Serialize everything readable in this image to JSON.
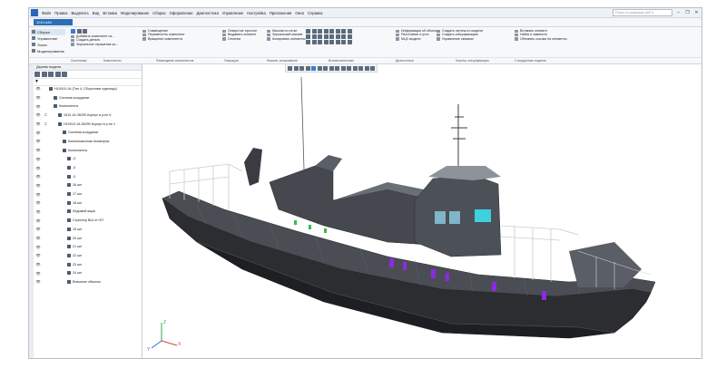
{
  "menu": [
    "Файл",
    "Правка",
    "Выделить",
    "Вид",
    "Вставка",
    "Моделирование",
    "Сборка",
    "Оформление",
    "Диагностика",
    "Управление",
    "Настройка",
    "Приложения",
    "Окно",
    "Справка"
  ],
  "search": {
    "placeholder": "Поиск по командам (Alt+/)"
  },
  "window_controls": [
    "–",
    "❐",
    "✕"
  ],
  "document": {
    "tab": "1010.a3d"
  },
  "modes": [
    "Сборка",
    "Управление",
    "Эскиз",
    "Моделирование"
  ],
  "ribbon": {
    "groups": [
      {
        "items": [
          "Добавить компонент из...",
          "Создать деталь",
          "Зеркальное отражение ко..."
        ]
      },
      {
        "items": [
          "Совмещение",
          "Переместить компонент",
          "Вращение компонента"
        ]
      },
      {
        "items": [
          "Отверстие простое",
          "Выдавить элемент",
          "Сечение"
        ]
      },
      {
        "items": [
          "Массив по сетке",
          "Зеркальный массив",
          "Копировать элементы"
        ]
      },
      {
        "items": [
          "Информация об объекте",
          "Расстояние и угол",
          "МЦХ модели"
        ]
      },
      {
        "items": [
          "Создать чертеж по модели",
          "Создать спецификацию",
          "Управление связями"
        ]
      },
      {
        "items": [
          "Вставить элемент",
          "Найти и заменить",
          "Обновить ссылки на элементы"
        ]
      }
    ],
    "labels": [
      "Системная",
      "Компоненты",
      "Размещение компонентов",
      "Операции",
      "Массив, копирование",
      "Вспомогательные",
      "Диагностика",
      "Чертеж, спецификация",
      "Стандартные изделия"
    ]
  },
  "panel": {
    "title": "Дерево модели"
  },
  "tree": [
    {
      "label": "Н10010.1А (Тип 4, Сборочные единицы)",
      "indent": 0
    },
    {
      "label": "Система координат",
      "indent": 1
    },
    {
      "label": "Компоненты",
      "indent": 1
    },
    {
      "label": "1010.1А.36290 Корпус в р-не 6",
      "indent": 2
    },
    {
      "label": "Н10010.1А.36290 Корпус в р-не 1",
      "indent": 2
    },
    {
      "label": "Система координат",
      "indent": 3
    },
    {
      "label": "Компоновочная геометрия",
      "indent": 3
    },
    {
      "label": "Компоненты",
      "indent": 3
    },
    {
      "label": "-0",
      "indent": 4
    },
    {
      "label": "-0",
      "indent": 4
    },
    {
      "label": "-0",
      "indent": 4
    },
    {
      "label": "16 шп",
      "indent": 4
    },
    {
      "label": "17 шп",
      "indent": 4
    },
    {
      "label": "18 шп",
      "indent": 4
    },
    {
      "label": "Ледовый ящик",
      "indent": 4
    },
    {
      "label": "Стрингер ВШ от ОП",
      "indent": 4
    },
    {
      "label": "19 шп",
      "indent": 4
    },
    {
      "label": "20 шп",
      "indent": 4
    },
    {
      "label": "21 шп",
      "indent": 4
    },
    {
      "label": "22 шп",
      "indent": 4
    },
    {
      "label": "23 шп",
      "indent": 4
    },
    {
      "label": "24 шп",
      "indent": 4
    },
    {
      "label": "Внешние объекты",
      "indent": 4
    }
  ],
  "colors": {
    "accent": "#2d6db8",
    "hull": "#2b2d31",
    "deck": "#3f4248",
    "window": "#8a2be2",
    "glass": "#3fd0e0"
  },
  "triad": {
    "x": "X",
    "y": "Y",
    "z": "Z"
  }
}
